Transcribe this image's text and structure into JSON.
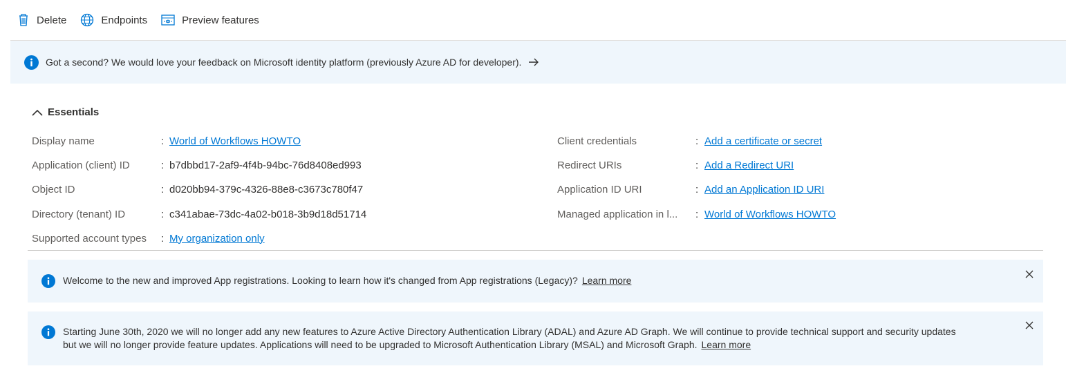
{
  "toolbar": {
    "delete_label": "Delete",
    "endpoints_label": "Endpoints",
    "preview_label": "Preview features"
  },
  "feedback": {
    "text": "Got a second? We would love your feedback on Microsoft identity platform (previously Azure AD for developer)."
  },
  "essentials": {
    "title": "Essentials",
    "colon": ":",
    "left": [
      {
        "label": "Display name",
        "value": "World of Workflows HOWTO",
        "is_link": true
      },
      {
        "label": "Application (client) ID",
        "value": "b7dbbd17-2af9-4f4b-94bc-76d8408ed993",
        "is_link": false
      },
      {
        "label": "Object ID",
        "value": "d020bb94-379c-4326-88e8-c3673c780f47",
        "is_link": false
      },
      {
        "label": "Directory (tenant) ID",
        "value": "c341abae-73dc-4a02-b018-3b9d18d51714",
        "is_link": false
      },
      {
        "label": "Supported account types",
        "value": "My organization only",
        "is_link": true
      }
    ],
    "right": [
      {
        "label": "Client credentials",
        "value": "Add a certificate or secret",
        "is_link": true
      },
      {
        "label": "Redirect URIs",
        "value": "Add a Redirect URI",
        "is_link": true
      },
      {
        "label": "Application ID URI",
        "value": "Add an Application ID URI",
        "is_link": true
      },
      {
        "label": "Managed application in l...",
        "value": "World of Workflows HOWTO",
        "is_link": true
      }
    ]
  },
  "messages": {
    "welcome": {
      "text": "Welcome to the new and improved App registrations. Looking to learn how it's changed from App registrations (Legacy)?",
      "link": "Learn more"
    },
    "adal": {
      "line1": "Starting June 30th, 2020 we will no longer add any new features to Azure Active Directory Authentication Library (ADAL) and Azure AD Graph. We will continue to provide technical support and security updates",
      "line2": "but we will no longer provide feature updates. Applications will need to be upgraded to Microsoft Authentication Library (MSAL) and Microsoft Graph.",
      "link": "Learn more"
    }
  },
  "colors": {
    "accent": "#0078d4",
    "banner_bg": "#eff6fc",
    "text": "#323130",
    "label": "#605e5c"
  }
}
